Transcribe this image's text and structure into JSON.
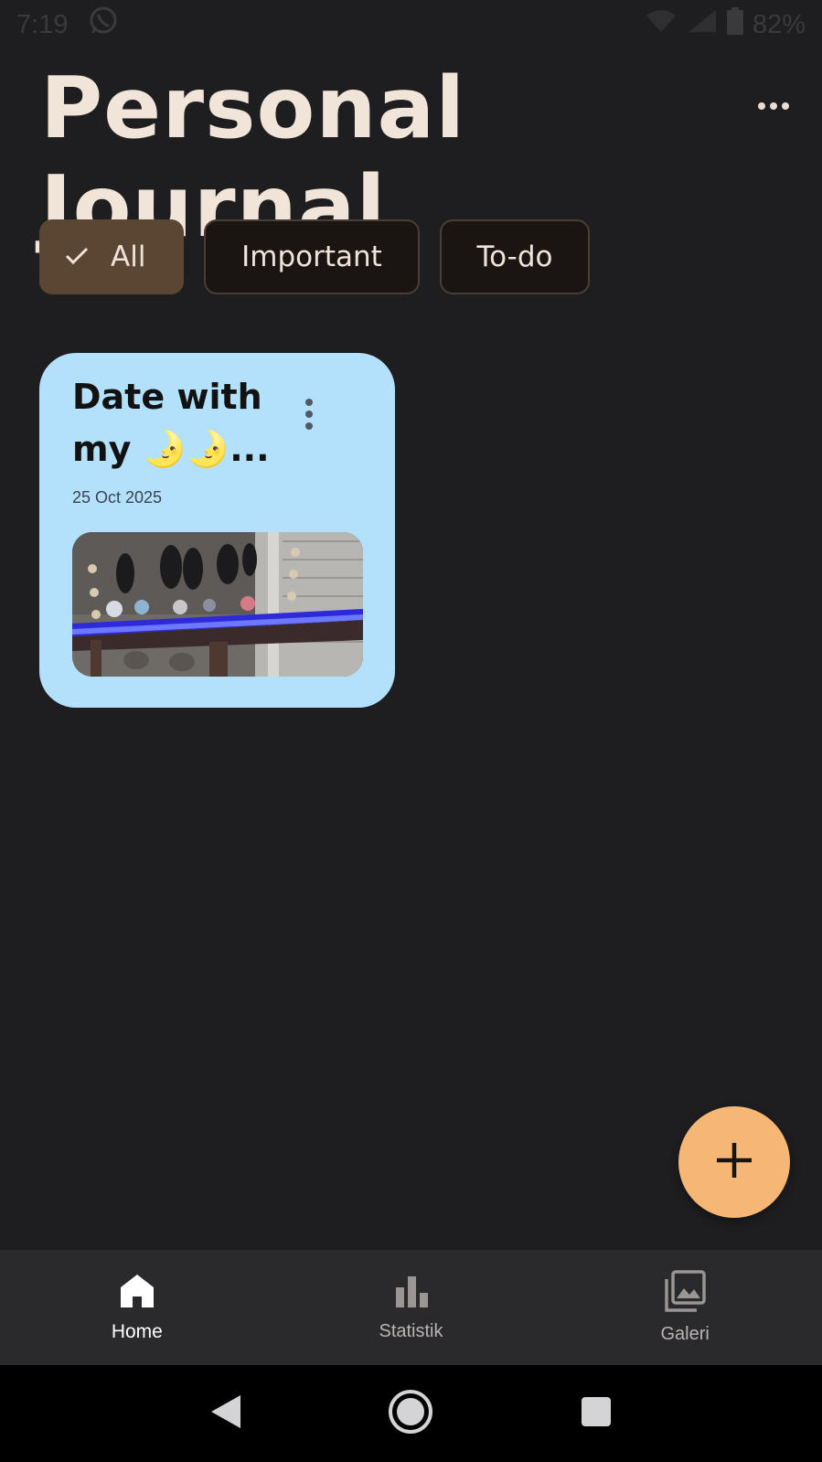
{
  "status_bar": {
    "time": "7:19",
    "battery": "82%",
    "icons": [
      "whatsapp-icon",
      "wifi-icon",
      "signal-icon",
      "battery-icon"
    ]
  },
  "header": {
    "title": "Personal Journal",
    "menu_icon": "more-horizontal-icon"
  },
  "filters": {
    "all_label": "All",
    "important_label": "Important",
    "todo_label": "To-do",
    "selected": "All"
  },
  "notes": [
    {
      "title": "Date with my 🌛🌛...",
      "date": "25 Oct 2025",
      "color": "#b3e1fb",
      "image": "photo-thumbnail"
    }
  ],
  "fab": {
    "icon": "plus-icon",
    "color": "#f6b676"
  },
  "bottom_nav": {
    "home_label": "Home",
    "stats_label": "Statistik",
    "gallery_label": "Galeri",
    "active": "Home"
  },
  "colors": {
    "background": "#1e1d1f",
    "selected_chip": "#5b4633",
    "card": "#b3e1fb",
    "accent": "#f6b676"
  }
}
